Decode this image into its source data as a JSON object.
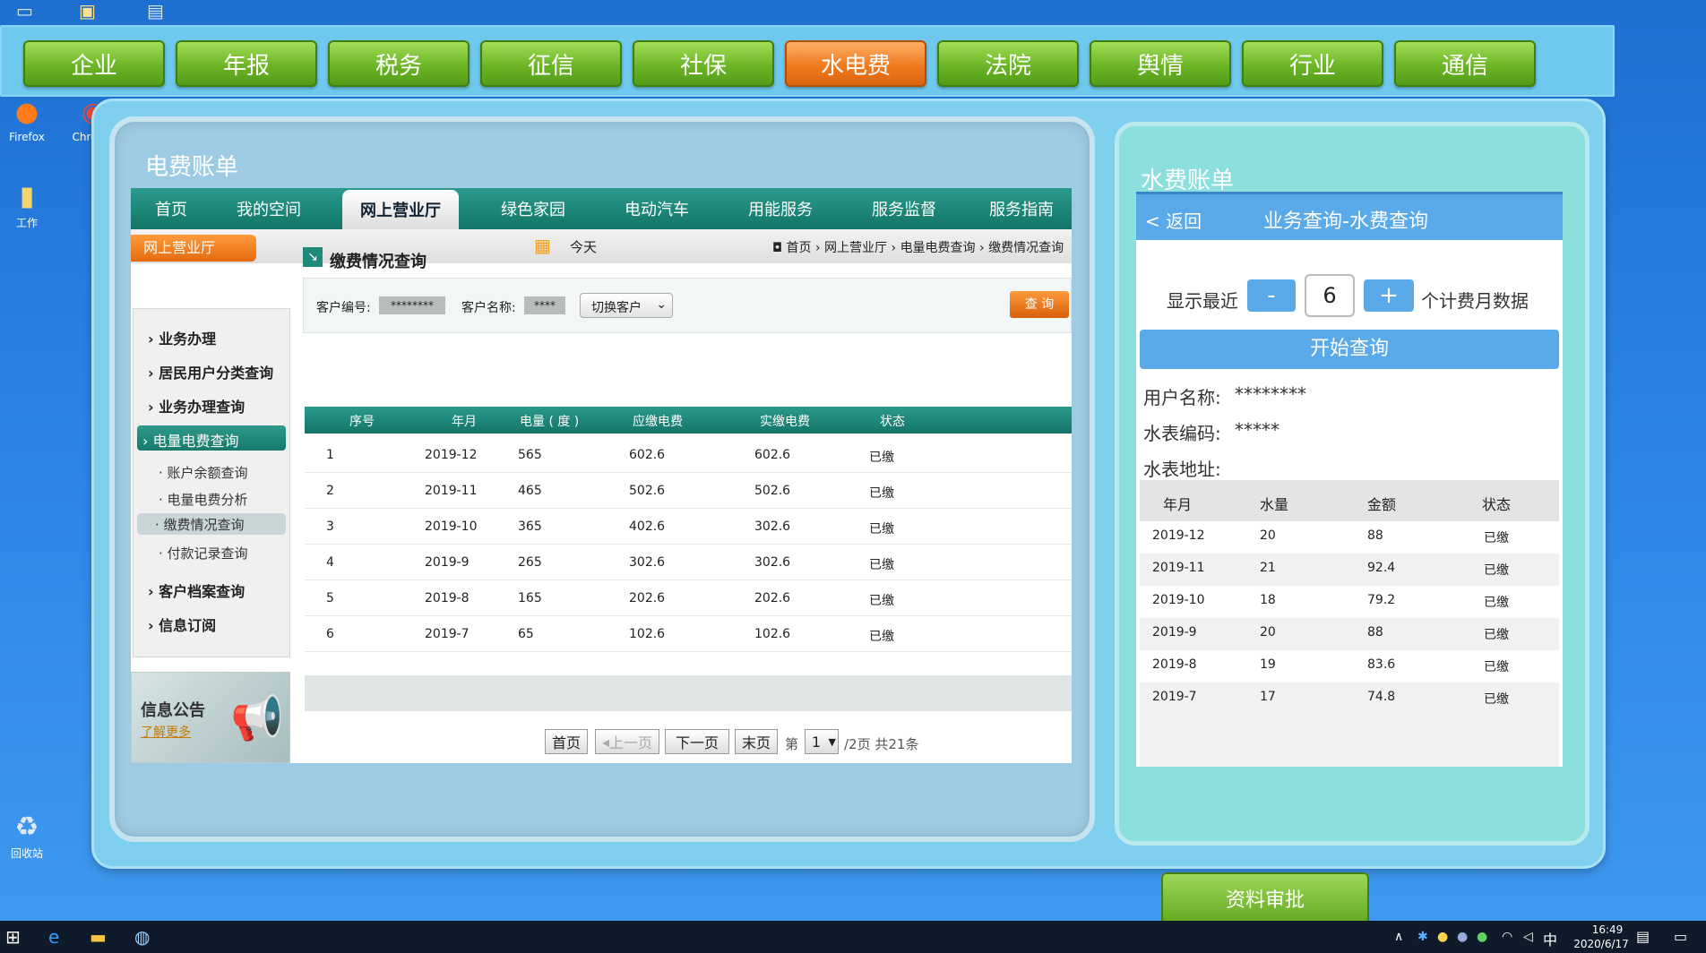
{
  "topnav": [
    "企业",
    "年报",
    "税务",
    "征信",
    "社保",
    "水电费",
    "法院",
    "舆情",
    "行业",
    "通信"
  ],
  "topnav_active": "水电费",
  "desktop": {
    "firefox": "Firefox",
    "chrome": "Chrome",
    "folder": "工作",
    "recycle": "回收站"
  },
  "electric": {
    "panel_title": "电费账单",
    "nav": [
      "首页",
      "我的空间",
      "网上营业厅",
      "绿色家园",
      "电动汽车",
      "用能服务",
      "服务监督",
      "服务指南"
    ],
    "nav_active": "网上营业厅",
    "section_tag": "网上营业厅",
    "today": "今天",
    "breadcrumb": [
      "首页",
      "网上营业厅",
      "电量电费查询",
      "缴费情况查询"
    ],
    "sidebar": [
      "业务办理",
      "居民用户分类查询",
      "业务办理查询",
      "电量电费查询"
    ],
    "sidebar_sub": [
      "账户余额查询",
      "电量电费分析",
      "缴费情况查询",
      "付款记录查询"
    ],
    "sidebar2": [
      "客户档案查询",
      "信息订阅"
    ],
    "notice_title": "信息公告",
    "notice_more": "了解更多",
    "page_title": "缴费情况查询",
    "customer_no_label": "客户编号:",
    "customer_no_value": "********",
    "customer_name_label": "客户名称:",
    "customer_name_value": "****",
    "switch_customer": "切换客户",
    "query_button": "查 询",
    "columns": [
      "序号",
      "年月",
      "电量 ( 度 )",
      "应缴电费",
      "实缴电费",
      "状态"
    ],
    "rows": [
      [
        "1",
        "2019-12",
        "565",
        "602.6",
        "602.6",
        "已缴"
      ],
      [
        "2",
        "2019-11",
        "465",
        "502.6",
        "502.6",
        "已缴"
      ],
      [
        "3",
        "2019-10",
        "365",
        "402.6",
        "302.6",
        "已缴"
      ],
      [
        "4",
        "2019-9",
        "265",
        "302.6",
        "302.6",
        "已缴"
      ],
      [
        "5",
        "2019-8",
        "165",
        "202.6",
        "202.6",
        "已缴"
      ],
      [
        "6",
        "2019-7",
        "65",
        "102.6",
        "102.6",
        "已缴"
      ]
    ],
    "pager": {
      "first": "首页",
      "prev": "上一页",
      "next": "下一页",
      "last": "末页",
      "page_prefix": "第",
      "page": "1",
      "suffix": "/2页 共21条"
    }
  },
  "water": {
    "panel_title": "水费账单",
    "back": "< 返回",
    "header_title": "业务查询-水费查询",
    "show_recent": "显示最近",
    "minus": "-",
    "count": "6",
    "plus": "+",
    "months_suffix": "个计费月数据",
    "start_query": "开始查询",
    "user_name_label": "用户名称:",
    "user_name_value": "********",
    "meter_code_label": "水表编码:",
    "meter_code_value": "*****",
    "meter_addr_label": "水表地址:",
    "columns": [
      "年月",
      "水量",
      "金额",
      "状态"
    ],
    "rows": [
      [
        "2019-12",
        "20",
        "88",
        "已缴"
      ],
      [
        "2019-11",
        "21",
        "92.4",
        "已缴"
      ],
      [
        "2019-10",
        "18",
        "79.2",
        "已缴"
      ],
      [
        "2019-9",
        "20",
        "88",
        "已缴"
      ],
      [
        "2019-8",
        "19",
        "83.6",
        "已缴"
      ],
      [
        "2019-7",
        "17",
        "74.8",
        "已缴"
      ]
    ]
  },
  "approve_button": "资料审批",
  "taskbar": {
    "ime": "中",
    "time": "16:49",
    "date": "2020/6/17"
  }
}
